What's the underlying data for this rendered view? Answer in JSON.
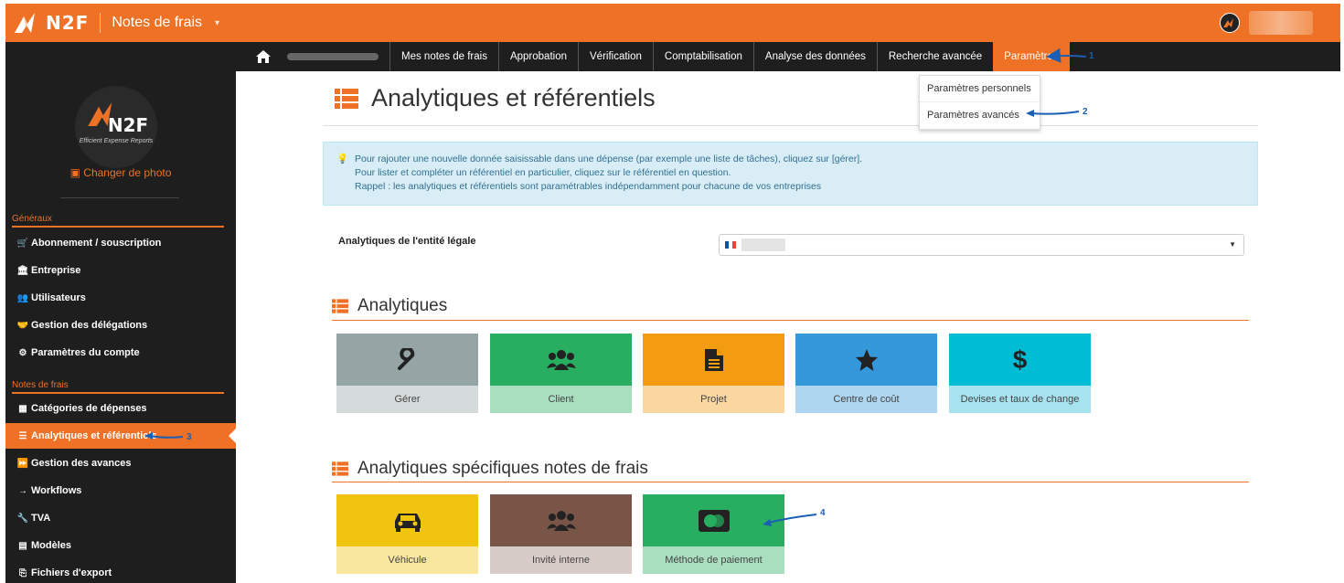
{
  "colors": {
    "accent": "#ee7125",
    "dark": "#1e1e1e",
    "annotation": "#1a5fb4"
  },
  "header": {
    "logo": "N2F",
    "app_title": "Notes de frais"
  },
  "nav": {
    "items": [
      {
        "label": "Mes notes de frais"
      },
      {
        "label": "Approbation"
      },
      {
        "label": "Vérification"
      },
      {
        "label": "Comptabilisation"
      },
      {
        "label": "Analyse des données"
      },
      {
        "label": "Recherche avancée"
      },
      {
        "label": "Paramètres"
      }
    ],
    "dropdown": [
      "Paramètres personnels",
      "Paramètres avancés"
    ]
  },
  "sidebar": {
    "logo_text": "N2F",
    "logo_tagline": "Efficient Expense Reports",
    "change_photo": "Changer de photo",
    "section_general": "Généraux",
    "general_items": [
      {
        "label": "Abonnement / souscription",
        "icon": "cart-icon"
      },
      {
        "label": "Entreprise",
        "icon": "bank-icon"
      },
      {
        "label": "Utilisateurs",
        "icon": "users-icon"
      },
      {
        "label": "Gestion des délégations",
        "icon": "handshake-icon"
      },
      {
        "label": "Paramètres du compte",
        "icon": "cogs-icon"
      }
    ],
    "section_expenses": "Notes de frais",
    "expense_items": [
      {
        "label": "Catégories de dépenses",
        "icon": "grid-icon"
      },
      {
        "label": "Analytiques et référentiels",
        "icon": "list-icon"
      },
      {
        "label": "Gestion des avances",
        "icon": "forward-icon"
      },
      {
        "label": "Workflows",
        "icon": "arrow-right-icon"
      },
      {
        "label": "TVA",
        "icon": "wrench-icon"
      },
      {
        "label": "Modèles",
        "icon": "template-icon"
      },
      {
        "label": "Fichiers d'export",
        "icon": "export-icon"
      }
    ]
  },
  "page": {
    "title": "Analytiques et référentiels",
    "info_lines": [
      "Pour rajouter une nouvelle donnée saisissable dans une dépense (par exemple une liste de tâches), cliquez sur [gérer].",
      "Pour lister et compléter un référentiel en particulier, cliquez sur le référentiel en question.",
      "Rappel : les analytiques et référentiels sont paramétrables indépendamment pour chacune de vos entreprises"
    ],
    "entity_label": "Analytiques de l'entité légale"
  },
  "analytiques": {
    "title": "Analytiques",
    "tiles": [
      {
        "label": "Gérer",
        "icon": "wrench-icon",
        "top": "#95a5a6",
        "bottom": "#d5dbdb"
      },
      {
        "label": "Client",
        "icon": "users-icon",
        "top": "#27ae60",
        "bottom": "#a9dfbf"
      },
      {
        "label": "Projet",
        "icon": "file-icon",
        "top": "#f39c12",
        "bottom": "#fad7a0"
      },
      {
        "label": "Centre de coût",
        "icon": "star-icon",
        "top": "#3498db",
        "bottom": "#aed6f1"
      },
      {
        "label": "Devises et taux de change",
        "icon": "dollar-icon",
        "top": "#00bcd4",
        "bottom": "#a6e3ef"
      }
    ]
  },
  "specifiques": {
    "title": "Analytiques spécifiques notes de frais",
    "tiles": [
      {
        "label": "Véhicule",
        "icon": "car-icon",
        "top": "#f1c40f",
        "bottom": "#f9e79f"
      },
      {
        "label": "Invité interne",
        "icon": "users-icon",
        "top": "#795548",
        "bottom": "#d7ccc8"
      },
      {
        "label": "Méthode de paiement",
        "icon": "card-icon",
        "top": "#27ae60",
        "bottom": "#a9dfbf"
      }
    ]
  },
  "annotations": [
    "1",
    "2",
    "3",
    "4"
  ]
}
